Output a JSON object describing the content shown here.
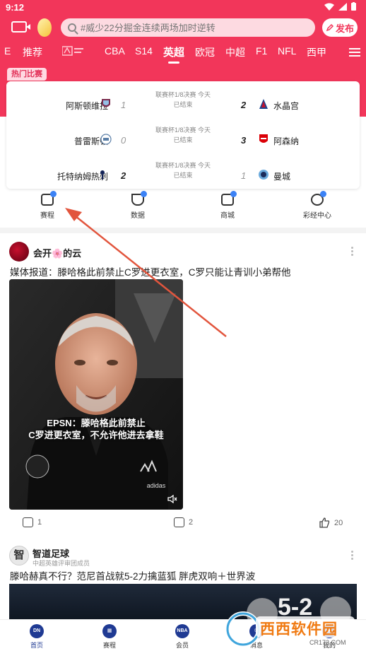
{
  "status_bar": {
    "time": "9:12"
  },
  "header": {
    "search_placeholder": "#威少22分掘金连续两场加时逆转",
    "publish_label": "发布"
  },
  "tabs": [
    "E",
    "推荐",
    "CBA",
    "S14",
    "英超",
    "欧冠",
    "中超",
    "F1",
    "NFL",
    "西甲"
  ],
  "active_tab": "英超",
  "hot_matches": {
    "badge": "热门比赛",
    "matches": [
      {
        "home": "阿斯顿维拉",
        "home_score": "1",
        "away": "水晶宫",
        "away_score": "2",
        "round": "联赛杯1/8决赛 今天",
        "status": "已结束",
        "winner": "away"
      },
      {
        "home": "普雷斯顿",
        "home_score": "0",
        "away": "阿森纳",
        "away_score": "3",
        "round": "联赛杯1/8决赛 今天",
        "status": "已结束",
        "winner": "away"
      },
      {
        "home": "托特纳姆热刺",
        "home_score": "2",
        "away": "曼城",
        "away_score": "1",
        "round": "联赛杯1/8决赛 今天",
        "status": "已结束",
        "winner": "home"
      }
    ]
  },
  "quick_nav": [
    {
      "label": "赛程",
      "icon": "calendar-icon"
    },
    {
      "label": "数据",
      "icon": "trophy-icon"
    },
    {
      "label": "商城",
      "icon": "shop-icon"
    },
    {
      "label": "彩经中心",
      "icon": "lottery-icon"
    }
  ],
  "posts": [
    {
      "author": "会开🌸的云",
      "title": "媒体报道：滕哈格此前禁止C罗进更衣室，C罗只能让青训小弟帮他",
      "video_caption_line1": "EPSN：滕哈格此前禁止",
      "video_caption_line2": "C罗进更衣室，不允许他进去拿鞋",
      "shares": "1",
      "comments": "2",
      "likes": "20"
    },
    {
      "author": "智道足球",
      "subtitle": "中超英雄评审团成员",
      "title": "滕哈赫真不行？范尼首战就5-2力擒蓝狐 胖虎双响＋世界波",
      "score_overlay": "5-2"
    }
  ],
  "bottom_nav": [
    {
      "label": "首页",
      "active": true
    },
    {
      "label": "赛程"
    },
    {
      "label": "会员"
    },
    {
      "label": "消息"
    },
    {
      "label": "我的"
    }
  ],
  "watermark": {
    "text": "西西软件园",
    "url": "CR173.COM"
  },
  "colors": {
    "brand": "#f2365a",
    "nav_blue": "#1f3a93",
    "arrow": "#e2553d"
  }
}
